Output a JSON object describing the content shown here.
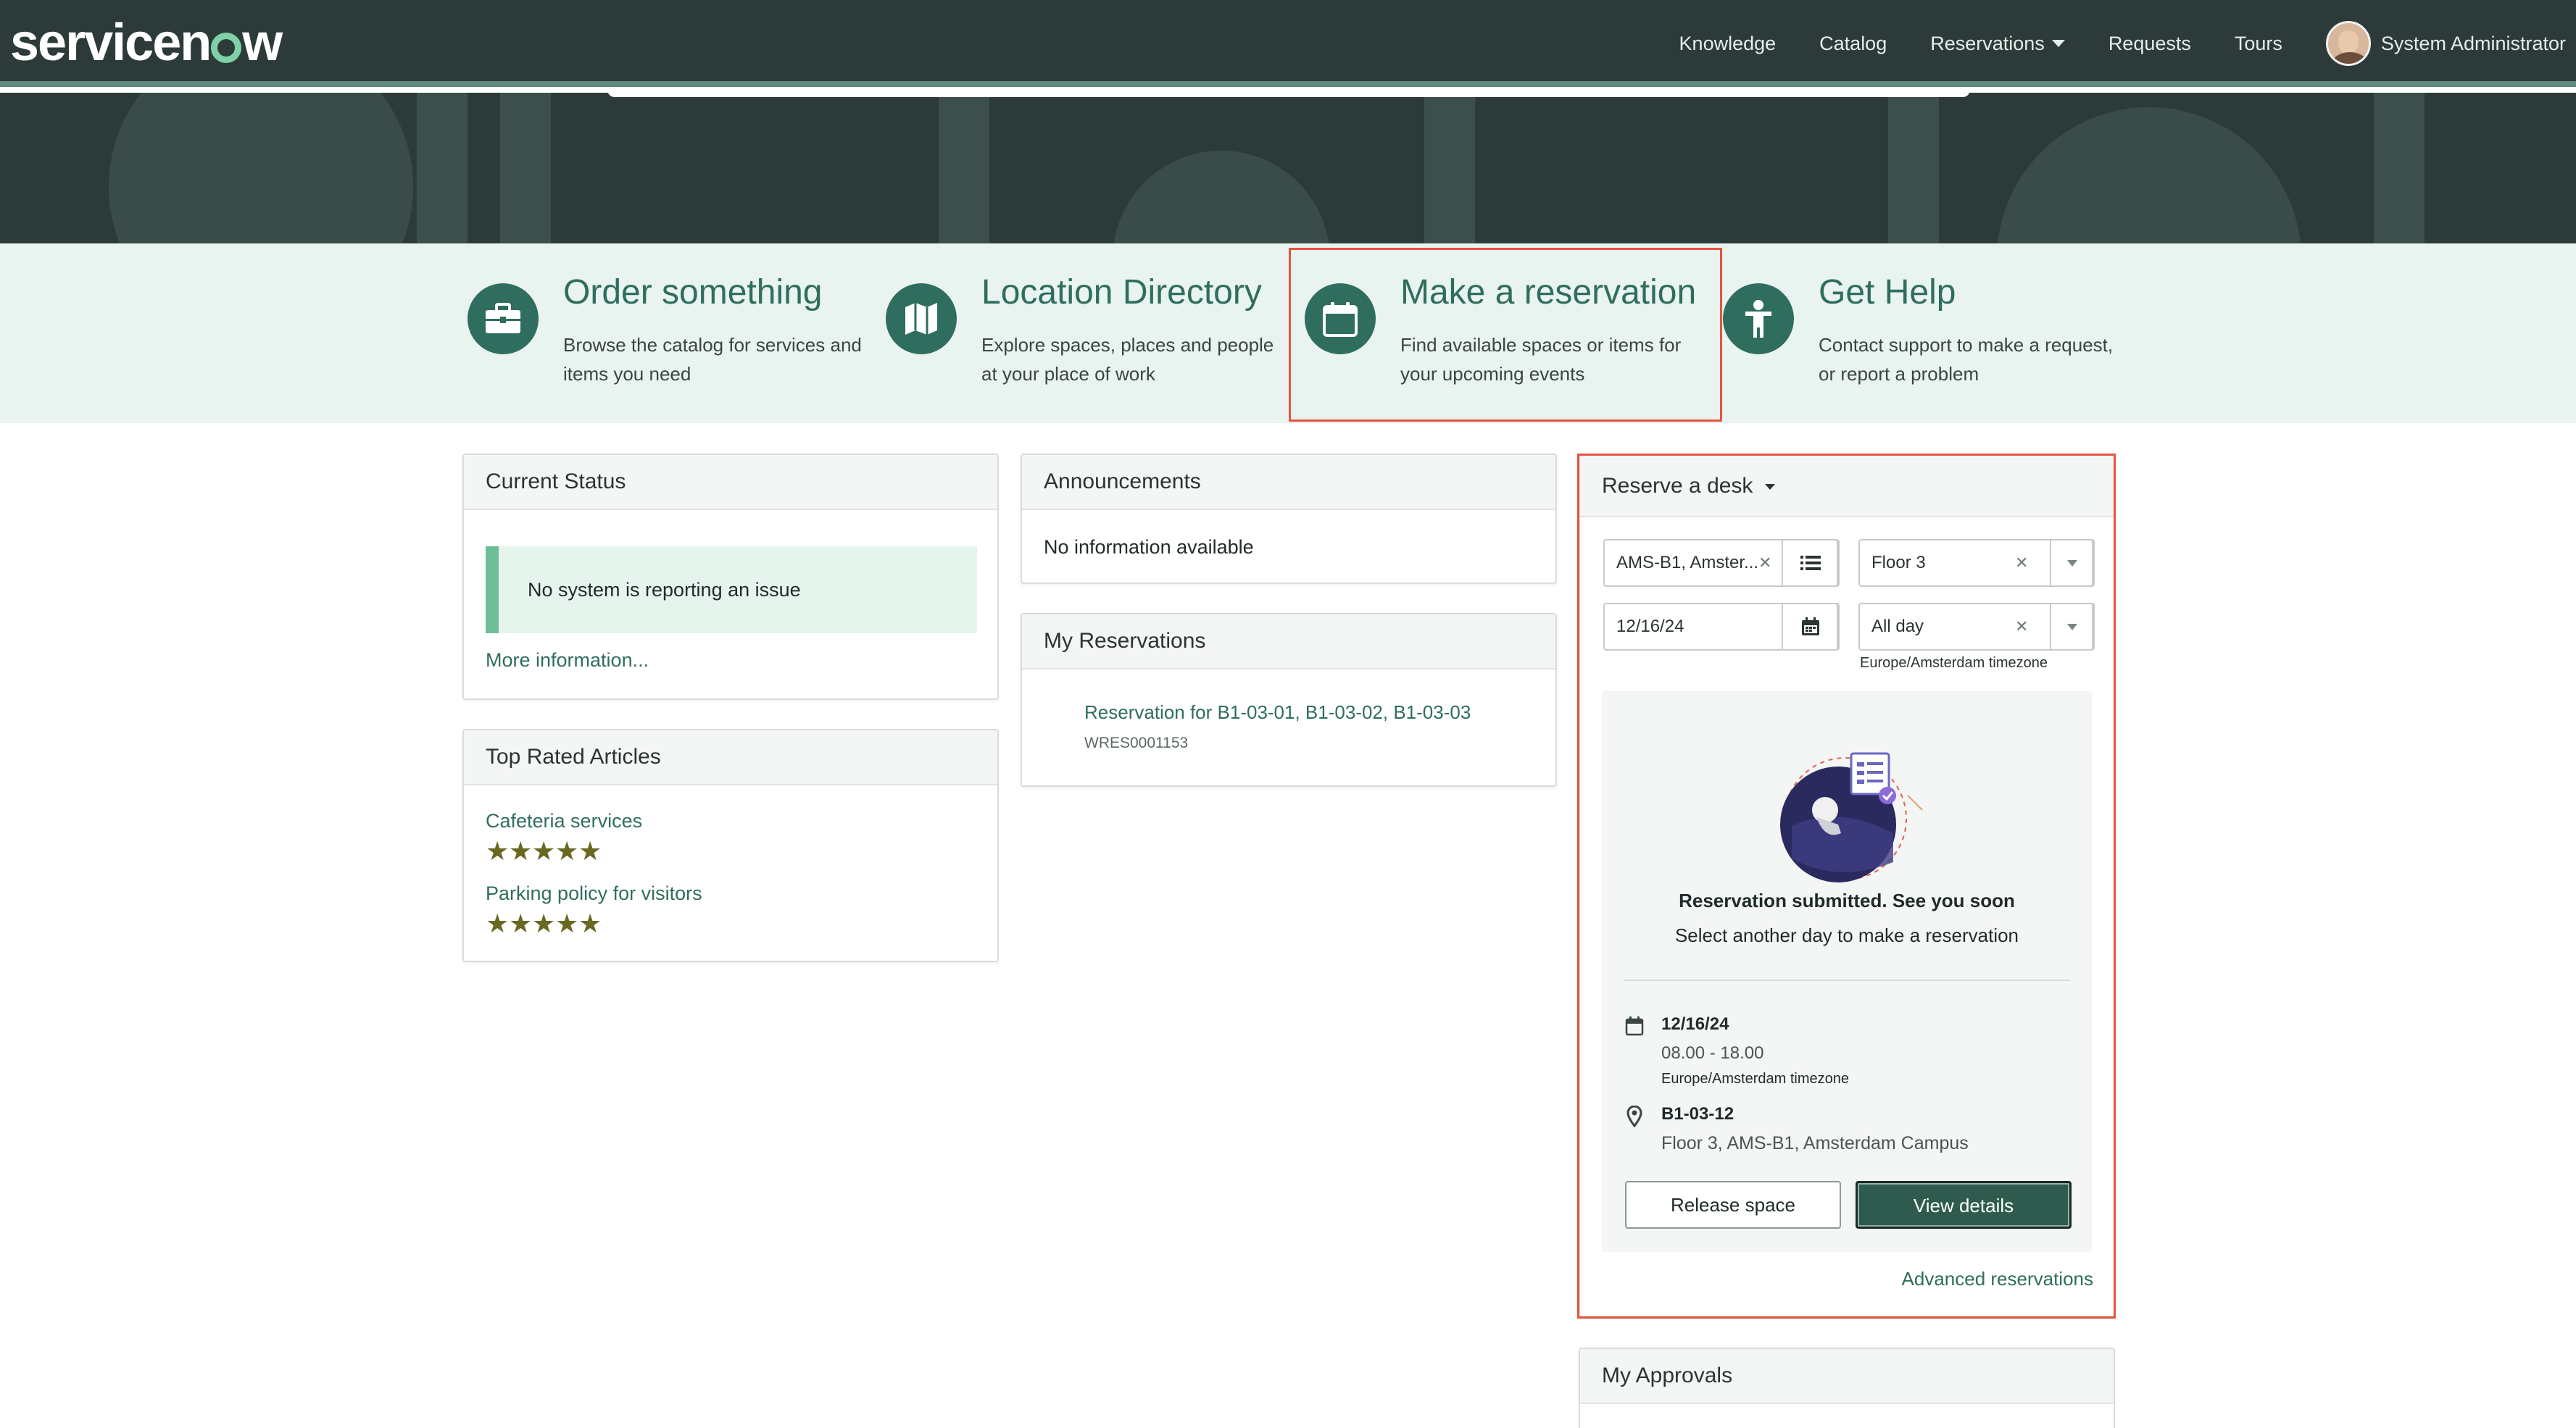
{
  "header": {
    "logo_text_a": "servicen",
    "logo_text_b": "w",
    "nav": [
      "Knowledge",
      "Catalog",
      "Reservations",
      "Requests",
      "Tours"
    ],
    "user_name": "System Administrator"
  },
  "quick_links": [
    {
      "title": "Order something",
      "desc": "Browse the catalog for services and items you need",
      "icon": "briefcase-icon"
    },
    {
      "title": "Location Directory",
      "desc": "Explore spaces, places and people at your place of work",
      "icon": "map-icon"
    },
    {
      "title": "Make a reservation",
      "desc": "Find available spaces or items for your upcoming events",
      "icon": "calendar-icon"
    },
    {
      "title": "Get Help",
      "desc": "Contact support to make a request, or report a problem",
      "icon": "person-help-icon"
    }
  ],
  "current_status": {
    "title": "Current Status",
    "message": "No system is reporting an issue",
    "more": "More information..."
  },
  "top_rated": {
    "title": "Top Rated Articles",
    "articles": [
      {
        "name": "Cafeteria services",
        "rating": 5
      },
      {
        "name": "Parking policy for visitors",
        "rating": 5
      }
    ]
  },
  "announcements": {
    "title": "Announcements",
    "empty": "No information available"
  },
  "my_reservations": {
    "title": "My Reservations",
    "item_title": "Reservation for B1-03-01, B1-03-02, B1-03-03",
    "item_number": "WRES0001153"
  },
  "reserve": {
    "title": "Reserve a desk",
    "building": "AMS-B1, Amster...",
    "floor": "Floor 3",
    "date": "12/16/24",
    "time": "All day",
    "timezone": "Europe/Amsterdam timezone",
    "confirm_title": "Reservation submitted. See you soon",
    "confirm_sub": "Select another day to make a reservation",
    "detail_date": "12/16/24",
    "detail_time": "08.00 - 18.00",
    "detail_tz": "Europe/Amsterdam timezone",
    "detail_space": "B1-03-12",
    "detail_location": "Floor 3, AMS-B1, Amsterdam Campus",
    "release_label": "Release space",
    "view_label": "View details",
    "advanced": "Advanced reservations",
    "accent": "#2f5b4f"
  },
  "approvals": {
    "title": "My Approvals"
  }
}
